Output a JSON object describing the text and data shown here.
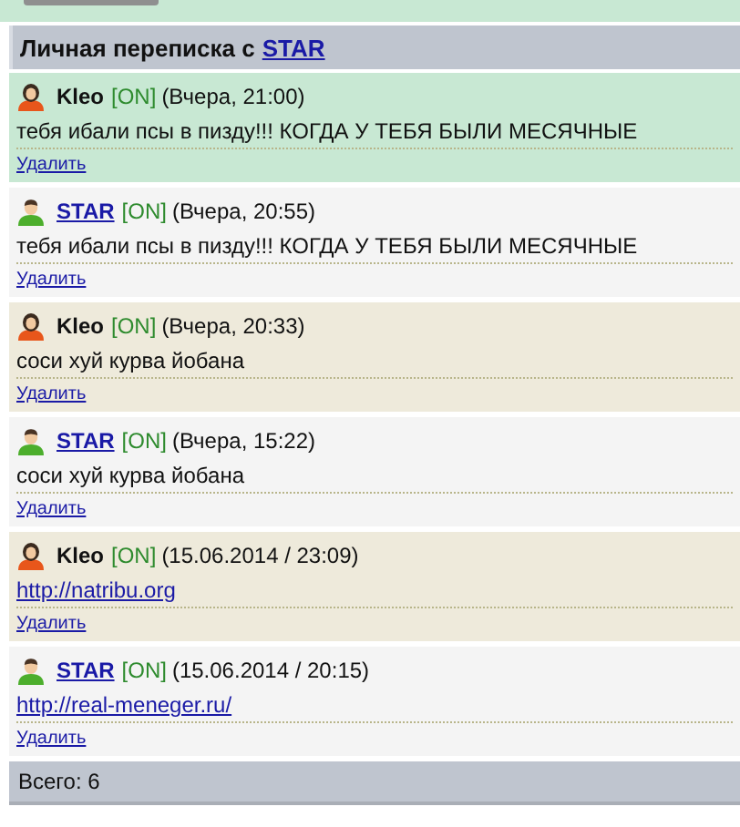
{
  "top_panel": {
    "kind": "cut_button"
  },
  "header": {
    "title": "Личная переписка с",
    "partner": "STAR"
  },
  "messages": [
    {
      "kind": "female",
      "highlighted": true,
      "author": "Kleo",
      "status": "[ON]",
      "time": "(Вчера, 21:00)",
      "body": {
        "kind": "text",
        "text": "тебя ибали псы в пизду!!! КОГДА У ТЕБЯ БЫЛИ МЕСЯЧНЫЕ"
      },
      "delete": "Удалить"
    },
    {
      "kind": "male",
      "highlighted": false,
      "author": "STAR",
      "status": "[ON]",
      "time": "(Вчера, 20:55)",
      "body": {
        "kind": "text",
        "text": "тебя ибали псы в пизду!!! КОГДА У ТЕБЯ БЫЛИ МЕСЯЧНЫЕ"
      },
      "delete": "Удалить"
    },
    {
      "kind": "female",
      "highlighted": false,
      "author": "Kleo",
      "status": "[ON]",
      "time": "(Вчера, 20:33)",
      "body": {
        "kind": "text",
        "text": "соси хуй курва йобана"
      },
      "delete": "Удалить"
    },
    {
      "kind": "male",
      "highlighted": false,
      "author": "STAR",
      "status": "[ON]",
      "time": "(Вчера, 15:22)",
      "body": {
        "kind": "text",
        "text": "соси хуй курва йобана"
      },
      "delete": "Удалить"
    },
    {
      "kind": "female",
      "highlighted": false,
      "author": "Kleo",
      "status": "[ON]",
      "time": "(15.06.2014 / 23:09)",
      "body": {
        "kind": "link",
        "text": "http://natribu.org"
      },
      "delete": "Удалить"
    },
    {
      "kind": "male",
      "highlighted": false,
      "author": "STAR",
      "status": "[ON]",
      "time": "(15.06.2014 / 20:15)",
      "body": {
        "kind": "link",
        "text": "http://real-meneger.ru/"
      },
      "delete": "Удалить"
    }
  ],
  "footer": {
    "total": "Всего: 6"
  }
}
